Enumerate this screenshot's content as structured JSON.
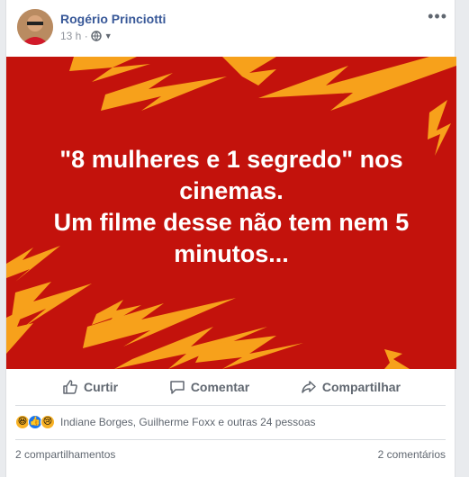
{
  "post": {
    "author": "Rogério Princiotti",
    "time": "13 h ·",
    "more_label": "•••"
  },
  "banner": {
    "line1": "\"8 mulheres e 1 segredo\" nos cinemas.",
    "line2": "Um filme desse não tem nem 5 minutos...",
    "background_color": "#c3120c",
    "bolt_color": "#f7a11b"
  },
  "actions": {
    "like": "Curtir",
    "comment": "Comentar",
    "share": "Compartilhar"
  },
  "reactions": {
    "icons": [
      "haha-icon",
      "like-icon",
      "sad-icon"
    ],
    "summary": "Indiane Borges, Guilherme Foxx e outras 24 pessoas"
  },
  "footer": {
    "shares": "2 compartilhamentos",
    "comments": "2 comentários"
  }
}
